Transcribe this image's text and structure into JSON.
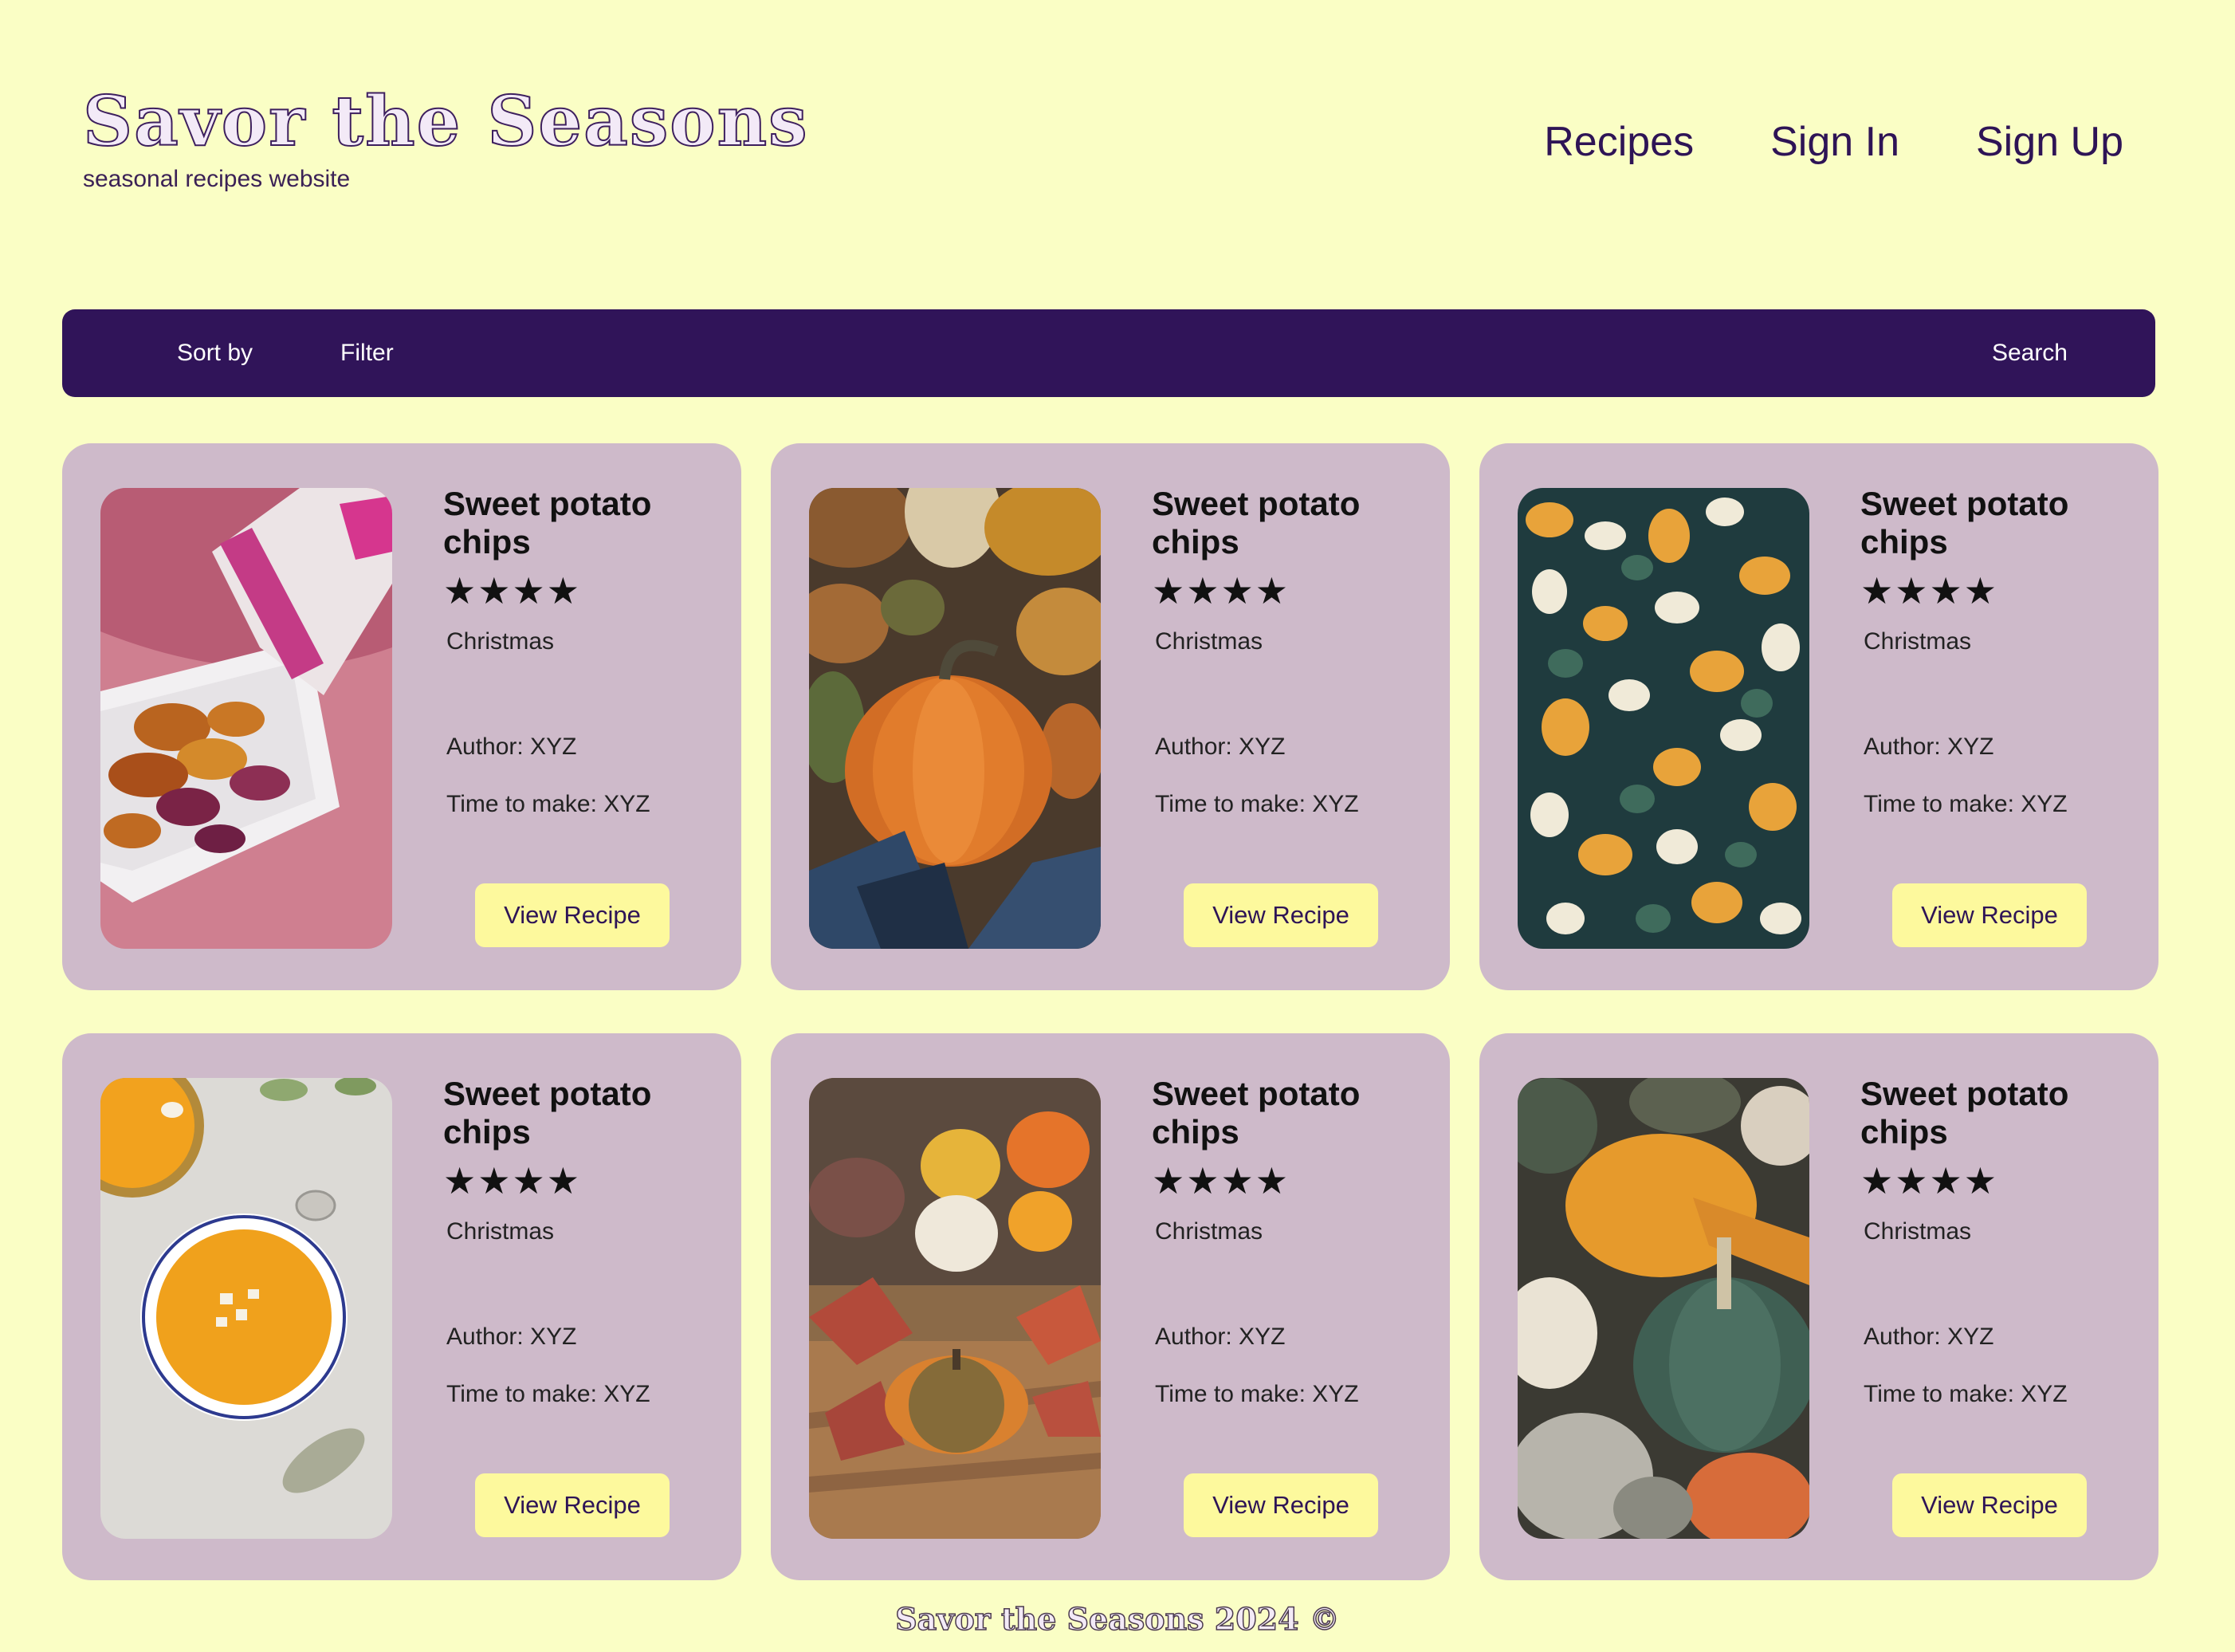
{
  "header": {
    "title": "Savor the Seasons",
    "subtitle": "seasonal recipes website"
  },
  "nav": {
    "recipes": "Recipes",
    "sign_in": "Sign In",
    "sign_up": "Sign Up"
  },
  "toolbar": {
    "sort_label": "Sort by",
    "filter_label": "Filter",
    "search_label": "Search"
  },
  "cards": [
    {
      "title": "Sweet potato chips",
      "stars": "★★★★",
      "rating": 4,
      "tag": "Christmas",
      "author": "Author: XYZ",
      "time": "Time to make: XYZ",
      "button": "View Recipe",
      "image": "sweet-potato-chips-photo"
    },
    {
      "title": "Sweet potato chips",
      "stars": "★★★★",
      "rating": 4,
      "tag": "Christmas",
      "author": "Author: XYZ",
      "time": "Time to make: XYZ",
      "button": "View Recipe",
      "image": "pumpkin-photo"
    },
    {
      "title": "Sweet potato chips",
      "stars": "★★★★",
      "rating": 4,
      "tag": "Christmas",
      "author": "Author: XYZ",
      "time": "Time to make: XYZ",
      "button": "View Recipe",
      "image": "gourds-photo"
    },
    {
      "title": "Sweet potato chips",
      "stars": "★★★★",
      "rating": 4,
      "tag": "Christmas",
      "author": "Author: XYZ",
      "time": "Time to make: XYZ",
      "button": "View Recipe",
      "image": "pumpkin-soup-photo"
    },
    {
      "title": "Sweet potato chips",
      "stars": "★★★★",
      "rating": 4,
      "tag": "Christmas",
      "author": "Author: XYZ",
      "time": "Time to make: XYZ",
      "button": "View Recipe",
      "image": "autumn-pumpkins-photo"
    },
    {
      "title": "Sweet potato chips",
      "stars": "★★★★",
      "rating": 4,
      "tag": "Christmas",
      "author": "Author: XYZ",
      "time": "Time to make: XYZ",
      "button": "View Recipe",
      "image": "squash-pile-photo"
    }
  ],
  "footer": {
    "text": "Savor the Seasons 2024 ©"
  },
  "colors": {
    "background": "#fafec5",
    "toolbar": "#301459",
    "card": "#cebaca",
    "button": "#fdf99d",
    "text": "#2e1456"
  }
}
